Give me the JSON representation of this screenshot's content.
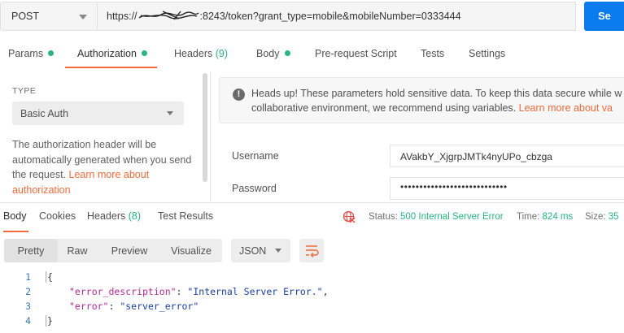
{
  "request": {
    "method": "POST",
    "url_prefix": "https://",
    "url_suffix": ":8243/token?grant_type=mobile&mobileNumber=0333444",
    "send_label": "Se"
  },
  "tabs": {
    "params": "Params",
    "authorization": "Authorization",
    "headers": "Headers",
    "headers_count": "(9)",
    "body": "Body",
    "prerequest": "Pre-request Script",
    "tests": "Tests",
    "settings": "Settings"
  },
  "auth": {
    "type_label": "TYPE",
    "type_value": "Basic Auth",
    "desc": "The authorization header will be automatically generated when you send the request. ",
    "desc_link": "Learn more about authorization",
    "headsup_line1": "Heads up! These parameters hold sensitive data. To keep this data secure while w",
    "headsup_line2": "collaborative environment, we recommend using variables. ",
    "headsup_link": "Learn more about va",
    "username_label": "Username",
    "username_value": "AVakbY_XjgrpJMTk4nyUPo_cbzga",
    "password_label": "Password",
    "password_value": "••••••••••••••••••••••••••••"
  },
  "response": {
    "tabs": {
      "body": "Body",
      "cookies": "Cookies",
      "headers": "Headers",
      "headers_count": "(8)",
      "test_results": "Test Results"
    },
    "status_label": "Status:",
    "status_value": "500 Internal Server Error",
    "time_label": "Time:",
    "time_value": "824 ms",
    "size_label": "Size:",
    "size_value": "35",
    "views": {
      "pretty": "Pretty",
      "raw": "Raw",
      "preview": "Preview",
      "visualize": "Visualize"
    },
    "format": "JSON",
    "code": {
      "ln1": "1",
      "ln2": "2",
      "ln3": "3",
      "ln4": "4",
      "open": "{",
      "key1": "\"error_description\"",
      "val1": "\"Internal Server Error.\"",
      "key2": "\"error\"",
      "val2": "\"server_error\"",
      "close": "}"
    }
  },
  "colors": {
    "accent": "#f26b3a",
    "success": "#26b47f",
    "send": "#097bed"
  }
}
